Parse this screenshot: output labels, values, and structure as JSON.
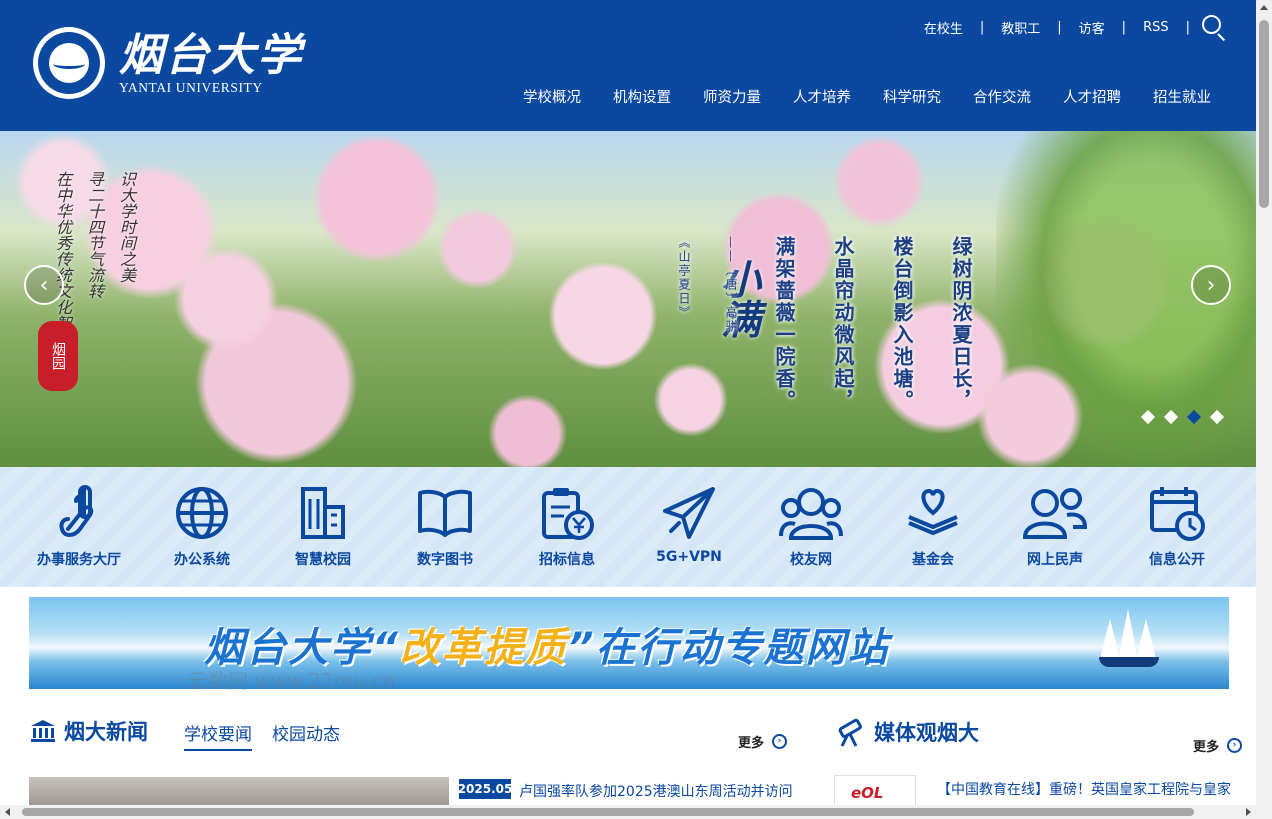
{
  "header": {
    "logo_cn": "烟台大学",
    "logo_en": "YANTAI UNIVERSITY",
    "top_links": [
      "在校生",
      "教职工",
      "访客",
      "RSS"
    ],
    "search_icon": "search-icon",
    "nav": [
      "学校概况",
      "机构设置",
      "师资力量",
      "人才培养",
      "科学研究",
      "合作交流",
      "人才招聘",
      "招生就业"
    ]
  },
  "banner": {
    "title": "小满",
    "poem": [
      "绿树阴浓夏日长，",
      "楼台倒影入池塘。",
      "水晶帘动微风起，",
      "满架蔷薇一院香。"
    ],
    "author": "——〔唐〕高骈",
    "source": "《山亭夏日》",
    "side_text": [
      "在中华优秀传统文化智慧中",
      "寻二十四节气流转",
      "识大学时间之美"
    ],
    "seal": "烟园",
    "prev_icon": "chevron-left-icon",
    "next_icon": "chevron-right-icon",
    "slides_count": 4,
    "active_slide": 3
  },
  "quick_links": [
    {
      "label": "办事服务大厅",
      "icon": "hand-pointer-icon"
    },
    {
      "label": "办公系统",
      "icon": "globe-icon"
    },
    {
      "label": "智慧校园",
      "icon": "building-icon"
    },
    {
      "label": "数字图书",
      "icon": "book-icon"
    },
    {
      "label": "招标信息",
      "icon": "clipboard-yen-icon"
    },
    {
      "label": "5G+VPN",
      "icon": "paper-plane-icon"
    },
    {
      "label": "校友网",
      "icon": "people-icon"
    },
    {
      "label": "基金会",
      "icon": "heart-hands-icon"
    },
    {
      "label": "网上民声",
      "icon": "users-icon"
    },
    {
      "label": "信息公开",
      "icon": "calendar-clock-icon"
    }
  ],
  "reform_banner": {
    "prefix": "烟台大学“",
    "highlight": "改革提质",
    "suffix": "”在行动专题网站"
  },
  "watermark": "云数网 www.22mu.cn",
  "news": {
    "title": "烟大新闻",
    "tabs": [
      "学校要闻",
      "校园动态"
    ],
    "active_tab": 0,
    "more": "更多",
    "first_date": "2025.05",
    "first_title": "卢国强率队参加2025港澳山东周活动并访问"
  },
  "media": {
    "title": "媒体观烟大",
    "more": "更多",
    "first_title": "【中国教育在线】重磅！英国皇家工程院与皇家",
    "logo_text": "eOL"
  },
  "colors": {
    "brand": "#0b48a0",
    "quick_bg": "#d7e7f7",
    "seal_red": "#c81e2a",
    "highlight_gold": "#f3b21a"
  }
}
